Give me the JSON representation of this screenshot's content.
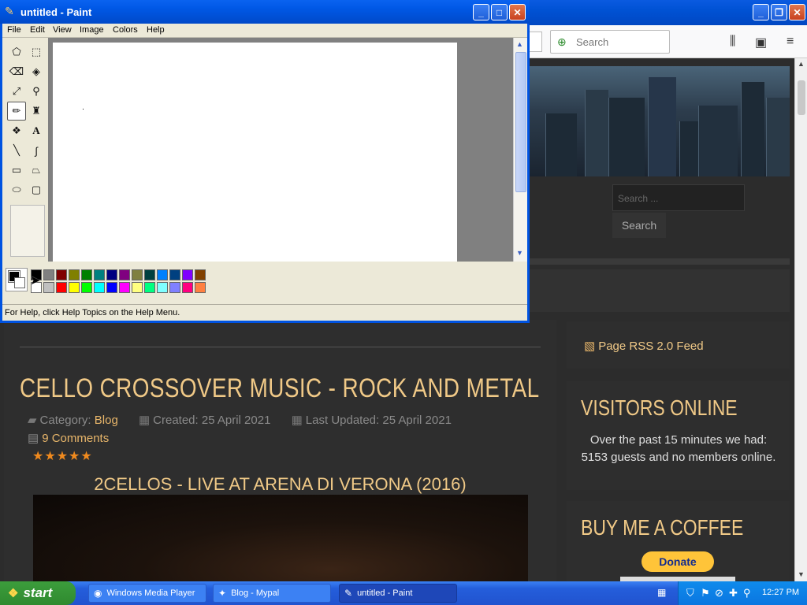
{
  "browser": {
    "search_placeholder": "Search",
    "page": {
      "widget_search_placeholder": "Search ...",
      "widget_search_button": "Search",
      "article": {
        "title": "CELLO CROSSOVER MUSIC - ROCK AND METAL",
        "category_label": "Category:",
        "category_value": "Blog",
        "created": "Created: 25 April 2021",
        "updated": "Last Updated: 25 April 2021",
        "comments": "9 Comments",
        "stars": "★★★★★",
        "video_title": "2CELLOS - LIVE AT ARENA DI VERONA (2016)"
      },
      "rss": "Page RSS 2.0 Feed",
      "visitors": {
        "heading": "VISITORS ONLINE",
        "body": "Over the past 15 minutes we had: 5153 guests and no members online."
      },
      "coffee": {
        "heading": "BUY ME A COFFEE",
        "donate": "Donate"
      }
    }
  },
  "paint": {
    "title": "untitled - Paint",
    "menu": [
      "File",
      "Edit",
      "View",
      "Image",
      "Colors",
      "Help"
    ],
    "status": "For Help, click Help Topics on the Help Menu.",
    "palette_top": [
      "#000000",
      "#808080",
      "#800000",
      "#808000",
      "#008000",
      "#008080",
      "#000080",
      "#800080",
      "#808040",
      "#004040",
      "#0080ff",
      "#004080",
      "#8000ff",
      "#804000"
    ],
    "palette_bottom": [
      "#ffffff",
      "#c0c0c0",
      "#ff0000",
      "#ffff00",
      "#00ff00",
      "#00ffff",
      "#0000ff",
      "#ff00ff",
      "#ffff80",
      "#00ff80",
      "#80ffff",
      "#8080ff",
      "#ff0080",
      "#ff8040"
    ]
  },
  "taskbar": {
    "start": "start",
    "tasks": [
      {
        "label": "Windows Media Player"
      },
      {
        "label": "Blog - Mypal"
      },
      {
        "label": "untitled - Paint"
      }
    ],
    "clock": "12:27 PM"
  }
}
